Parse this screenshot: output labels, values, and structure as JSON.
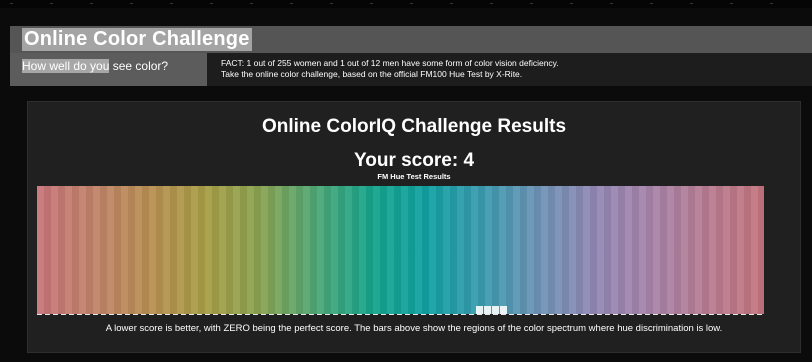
{
  "header": {
    "title": "Online Color Challenge",
    "tagline_highlight": "How well do you",
    "tagline_rest": " see color?",
    "fact_line1": "FACT: 1 out of 255 women and 1 out of 12 men have some form of color vision deficiency.",
    "fact_line2": "Take the online color challenge, based on the official FM100 Hue Test by X-Rite."
  },
  "results": {
    "title": "Online ColorIQ Challenge Results",
    "score_label": "Your score: ",
    "score_value": "4",
    "subtitle": "FM Hue Test Results",
    "caption": "A lower score is better, with ZERO being the perfect score. The bars above show the regions of the color spectrum where hue discrimination is low."
  },
  "spectrum": {
    "gradient_stops": [
      "#c8757a",
      "#c2836a",
      "#b98f52",
      "#a89e47",
      "#8aa351",
      "#4da876",
      "#15a48d",
      "#11a1a3",
      "#3d9bb0",
      "#6f93b6",
      "#9388b5",
      "#a884a9",
      "#b87c91",
      "#c4757e"
    ],
    "error_bars": [
      {
        "position": 0.604,
        "level": 0.06
      },
      {
        "position": 0.615,
        "level": 0.06
      },
      {
        "position": 0.626,
        "level": 0.06
      },
      {
        "position": 0.637,
        "level": 0.06
      }
    ]
  }
}
